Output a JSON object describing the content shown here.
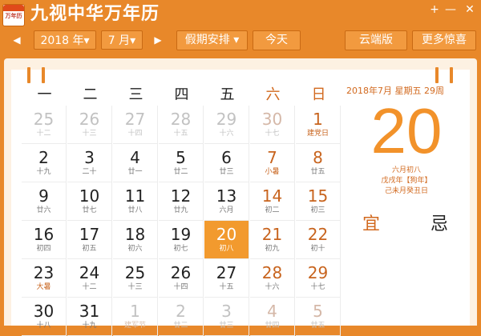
{
  "app": {
    "logo_text": "万年历",
    "title": "九视中华万年历"
  },
  "window": {
    "pin_label": "+",
    "minimize_label": "—",
    "close_label": "✕"
  },
  "toolbar": {
    "prev_arrow": "◀",
    "year_select": "2018 年▾",
    "month_select": "7 月▾",
    "next_arrow": "▶",
    "holiday_button": "假期安排 ▾",
    "today_button": "今天",
    "cloud_button": "云端版",
    "surprise_button": "更多惊喜"
  },
  "weekdays": [
    "一",
    "二",
    "三",
    "四",
    "五",
    "六",
    "日"
  ],
  "calendar": {
    "rows": [
      [
        {
          "day": "25",
          "sub": "十二",
          "other": true
        },
        {
          "day": "26",
          "sub": "十三",
          "other": true
        },
        {
          "day": "27",
          "sub": "十四",
          "other": true
        },
        {
          "day": "28",
          "sub": "十五",
          "other": true
        },
        {
          "day": "29",
          "sub": "十六",
          "other": true
        },
        {
          "day": "30",
          "sub": "十七",
          "other": true
        },
        {
          "day": "1",
          "sub": "建党日",
          "term": true
        }
      ],
      [
        {
          "day": "2",
          "sub": "十九"
        },
        {
          "day": "3",
          "sub": "二十"
        },
        {
          "day": "4",
          "sub": "廿一"
        },
        {
          "day": "5",
          "sub": "廿二"
        },
        {
          "day": "6",
          "sub": "廿三"
        },
        {
          "day": "7",
          "sub": "小暑",
          "term": true
        },
        {
          "day": "8",
          "sub": "廿五"
        }
      ],
      [
        {
          "day": "9",
          "sub": "廿六"
        },
        {
          "day": "10",
          "sub": "廿七"
        },
        {
          "day": "11",
          "sub": "廿八"
        },
        {
          "day": "12",
          "sub": "廿九"
        },
        {
          "day": "13",
          "sub": "六月"
        },
        {
          "day": "14",
          "sub": "初二"
        },
        {
          "day": "15",
          "sub": "初三"
        }
      ],
      [
        {
          "day": "16",
          "sub": "初四"
        },
        {
          "day": "17",
          "sub": "初五"
        },
        {
          "day": "18",
          "sub": "初六"
        },
        {
          "day": "19",
          "sub": "初七"
        },
        {
          "day": "20",
          "sub": "初八",
          "today": true
        },
        {
          "day": "21",
          "sub": "初九"
        },
        {
          "day": "22",
          "sub": "初十"
        }
      ],
      [
        {
          "day": "23",
          "sub": "大暑",
          "term": true
        },
        {
          "day": "24",
          "sub": "十二"
        },
        {
          "day": "25",
          "sub": "十三"
        },
        {
          "day": "26",
          "sub": "十四"
        },
        {
          "day": "27",
          "sub": "十五"
        },
        {
          "day": "28",
          "sub": "十六"
        },
        {
          "day": "29",
          "sub": "十七"
        }
      ],
      [
        {
          "day": "30",
          "sub": "十八"
        },
        {
          "day": "31",
          "sub": "十九"
        },
        {
          "day": "1",
          "sub": "建军节",
          "other": true,
          "term": true
        },
        {
          "day": "2",
          "sub": "廿二",
          "other": true
        },
        {
          "day": "3",
          "sub": "廿三",
          "other": true
        },
        {
          "day": "4",
          "sub": "廿四",
          "other": true
        },
        {
          "day": "5",
          "sub": "廿五",
          "other": true
        }
      ]
    ]
  },
  "info": {
    "date_line": "2018年7月   星期五   29周",
    "big_day": "20",
    "lunar_date": "六月初八",
    "ganzhi_year": "戊戌年【狗年】",
    "ganzhi_month_day": "己未月癸丑日",
    "yi_label": "宜",
    "ji_label": "忌"
  },
  "colors": {
    "accent": "#e8882a",
    "today_cell": "#f29a2e",
    "weekend_text": "#c8641e",
    "panel_bg": "#fdf1e2"
  }
}
